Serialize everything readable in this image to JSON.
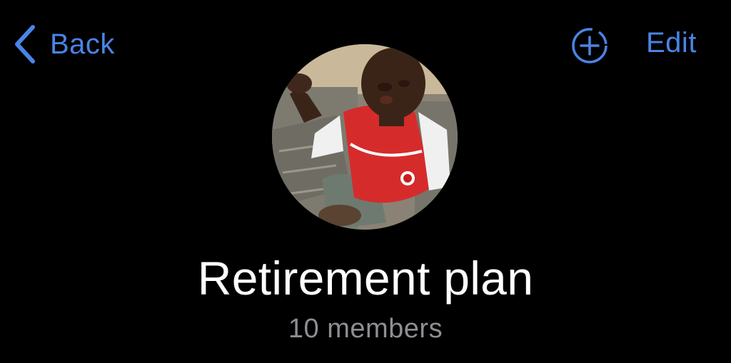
{
  "nav": {
    "back_label": "Back",
    "edit_label": "Edit",
    "back_icon": "chevron-left-icon",
    "add_icon": "add-circle-dashed-icon"
  },
  "group": {
    "title": "Retirement plan",
    "member_count": "10 members",
    "avatar_description": "child in red and white football shirt"
  },
  "colors": {
    "background": "#000000",
    "accent": "#4a84e6",
    "title": "#ffffff",
    "subtitle": "#8e8e93"
  }
}
